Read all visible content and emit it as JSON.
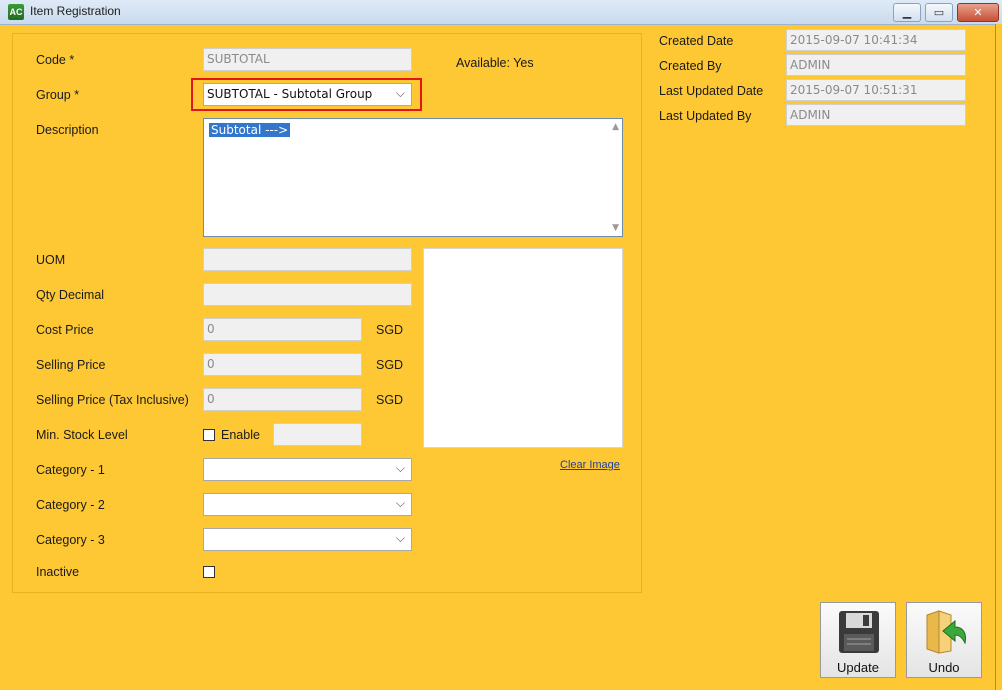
{
  "window": {
    "title": "Item Registration",
    "app_icon_text": "AC",
    "minimize_icon": "minimize-icon",
    "maximize_icon": "maximize-icon",
    "close_icon": "close-icon"
  },
  "form": {
    "code_label": "Code *",
    "code_value": "SUBTOTAL",
    "available_text": "Available: Yes",
    "group_label": "Group *",
    "group_value": "SUBTOTAL - Subtotal Group",
    "description_label": "Description",
    "description_value": "Subtotal --->",
    "uom_label": "UOM",
    "uom_value": "",
    "qty_decimal_label": "Qty Decimal",
    "qty_decimal_value": "",
    "cost_price_label": "Cost Price",
    "cost_price_value": "0",
    "cost_currency": "SGD",
    "selling_price_label": "Selling Price",
    "selling_price_value": "0",
    "selling_currency": "SGD",
    "selling_tax_label": "Selling Price (Tax Inclusive)",
    "selling_tax_value": "0",
    "selling_tax_currency": "SGD",
    "min_stock_label": "Min. Stock Level",
    "min_stock_enable_label": "Enable",
    "min_stock_enabled": false,
    "min_stock_value": "",
    "category1_label": "Category - 1",
    "category1_value": "",
    "category2_label": "Category - 2",
    "category2_value": "",
    "category3_label": "Category - 3",
    "category3_value": "",
    "inactive_label": "Inactive",
    "inactive_checked": false,
    "clear_image_label": "Clear Image"
  },
  "audit": {
    "created_date_label": "Created Date",
    "created_date_value": "2015-09-07 10:41:34",
    "created_by_label": "Created By",
    "created_by_value": "ADMIN",
    "last_updated_date_label": "Last Updated Date",
    "last_updated_date_value": "2015-09-07 10:51:31",
    "last_updated_by_label": "Last Updated By",
    "last_updated_by_value": "ADMIN"
  },
  "actions": {
    "update_label": "Update",
    "update_icon": "floppy-disk-icon",
    "undo_label": "Undo",
    "undo_icon": "folder-undo-icon"
  },
  "colors": {
    "background": "#fec835",
    "highlight_border": "#e3171a",
    "selection": "#3377cc"
  }
}
